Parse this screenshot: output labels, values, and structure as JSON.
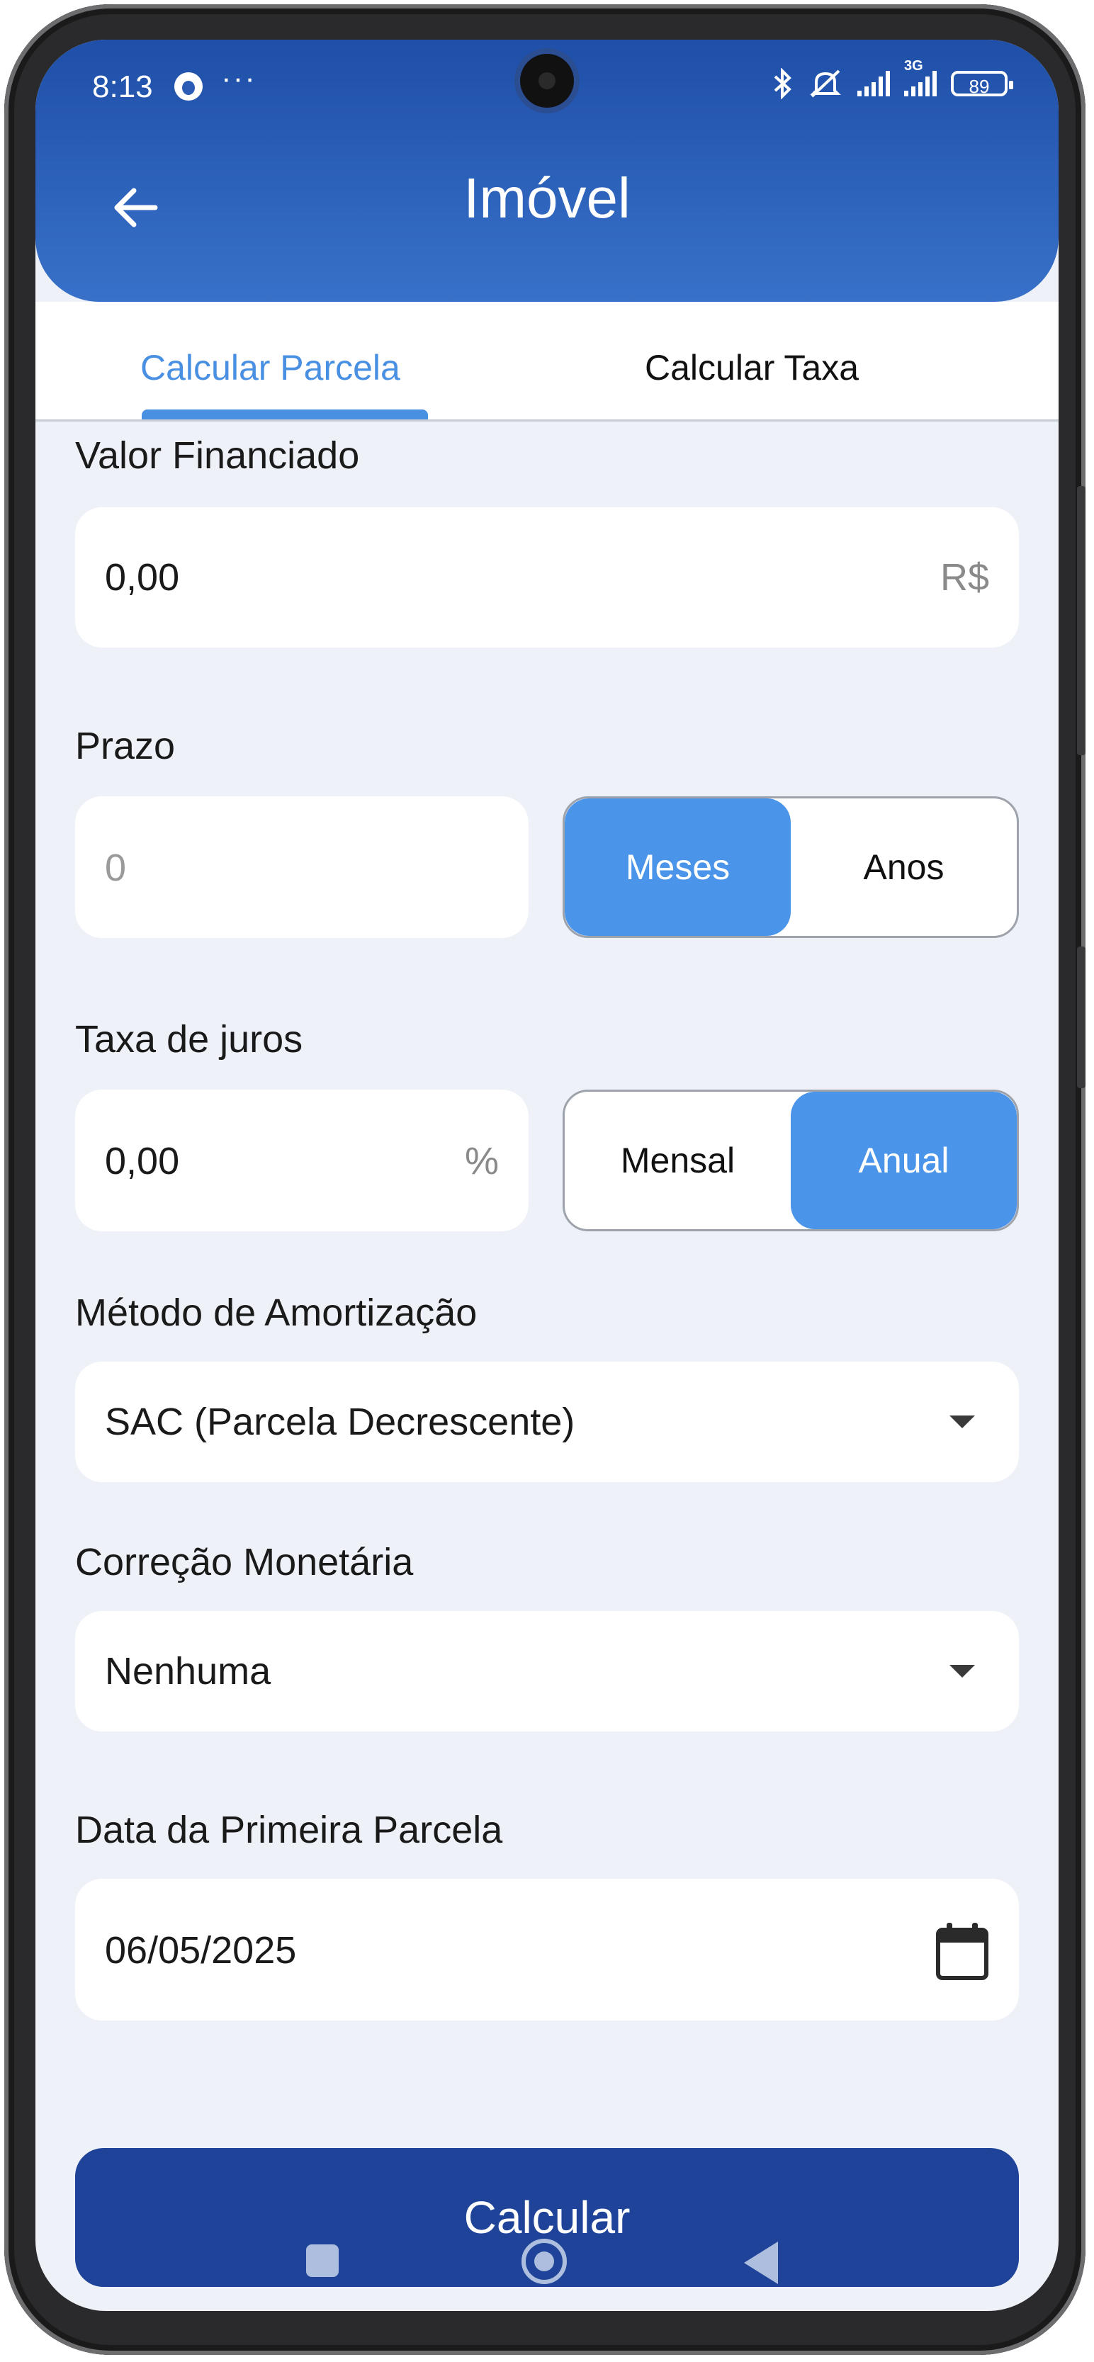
{
  "status_bar": {
    "time": "8:13",
    "more": "···",
    "battery": "89",
    "network": "3G"
  },
  "header": {
    "title": "Imóvel",
    "back_icon": "arrow-left-icon"
  },
  "tabs": [
    {
      "label": "Calcular Parcela",
      "active": true
    },
    {
      "label": "Calcular Taxa",
      "active": false
    }
  ],
  "form": {
    "valor_financiado": {
      "label": "Valor Financiado",
      "value": "0,00",
      "suffix": "R$"
    },
    "prazo": {
      "label": "Prazo",
      "placeholder": "0",
      "options": [
        "Meses",
        "Anos"
      ],
      "selected": "Meses"
    },
    "taxa": {
      "label": "Taxa de juros",
      "value": "0,00",
      "suffix": "%",
      "options": [
        "Mensal",
        "Anual"
      ],
      "selected": "Anual"
    },
    "amortizacao": {
      "label": "Método de Amortização",
      "value": "SAC (Parcela Decrescente)"
    },
    "correcao": {
      "label": "Correção Monetária",
      "value": "Nenhuma"
    },
    "data": {
      "label": "Data da Primeira Parcela",
      "value": "06/05/2025",
      "icon": "calendar-icon"
    }
  },
  "actions": {
    "calculate_label": "Calcular"
  },
  "colors": {
    "primary": "#1e4399",
    "accent": "#4a94ea",
    "background": "#eef2f8"
  }
}
